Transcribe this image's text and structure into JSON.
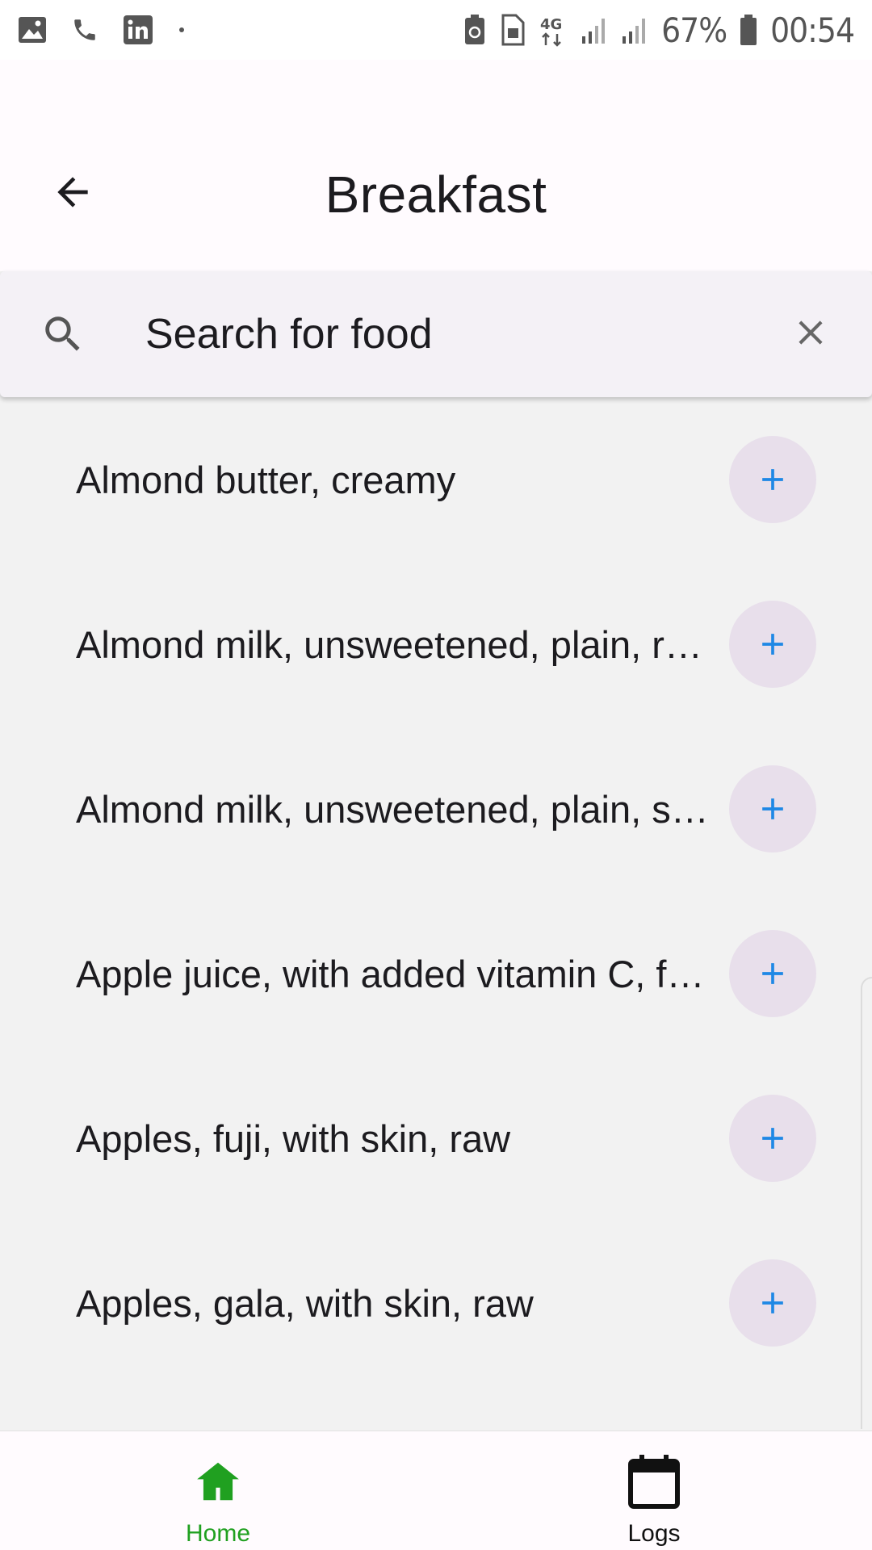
{
  "status_bar": {
    "battery_percent": "67%",
    "time": "00:54",
    "network": "4G"
  },
  "header": {
    "title": "Breakfast",
    "back_icon": "arrow-left-icon"
  },
  "search": {
    "placeholder": "Search for food",
    "value": ""
  },
  "foods": [
    {
      "label": "Almond butter, creamy"
    },
    {
      "label": "Almond milk, unsweetened, plain, refrigerated"
    },
    {
      "label": "Almond milk, unsweetened, plain, shelf stable"
    },
    {
      "label": "Apple juice, with added vitamin C, from concentrate"
    },
    {
      "label": "Apples, fuji, with skin, raw"
    },
    {
      "label": "Apples, gala, with skin, raw"
    }
  ],
  "bottom_nav": {
    "home": {
      "label": "Home",
      "active": true
    },
    "logs": {
      "label": "Logs",
      "active": false
    }
  },
  "colors": {
    "accent_add": "#1e88e5",
    "add_button_bg": "#e8dfeb",
    "nav_active": "#20a020",
    "nav_inactive": "#111111"
  }
}
